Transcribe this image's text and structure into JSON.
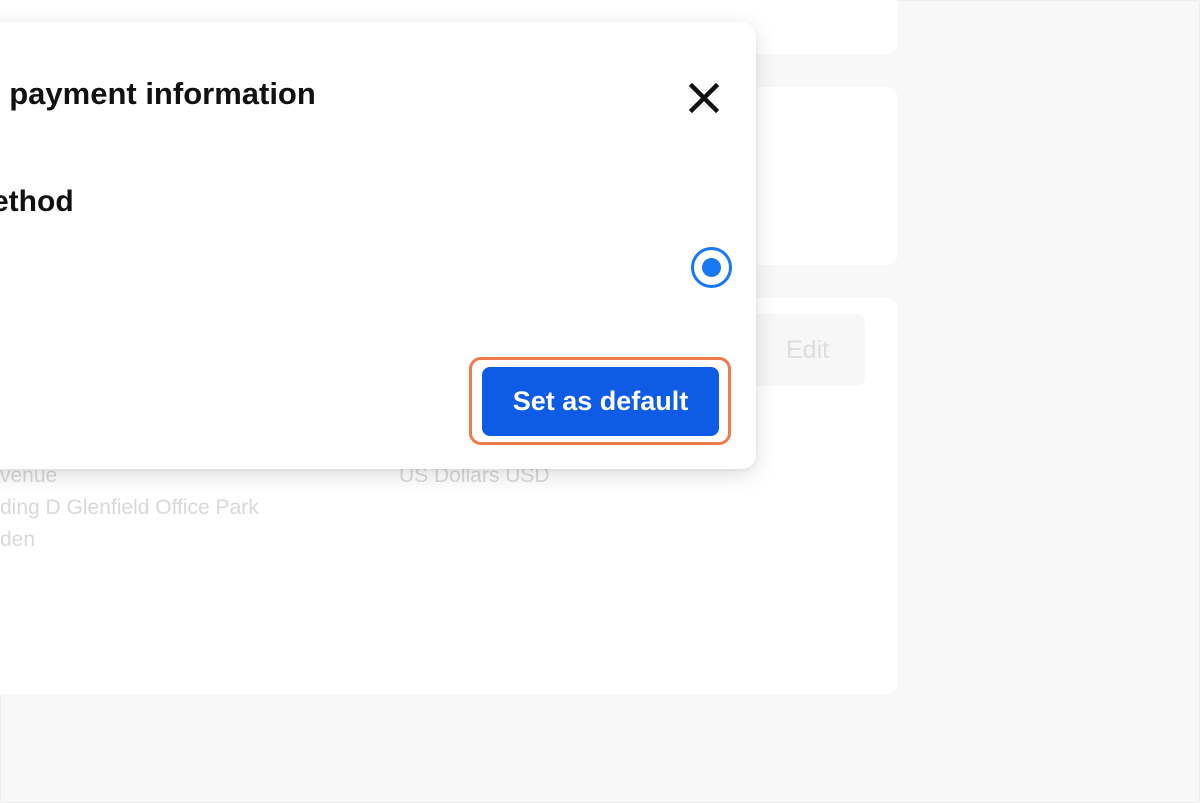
{
  "background": {
    "edit_label": "Edit",
    "address_lines": [
      "venue",
      "ding D Glenfield Office Park",
      "den"
    ],
    "currency": "US Dollars USD"
  },
  "modal": {
    "title": "l payment information",
    "section_title": "ethod",
    "close_icon": "close-icon",
    "radio_selected": true,
    "primary_button_label": "Set as default"
  },
  "colors": {
    "accent": "#1877f2",
    "primary_button": "#0e5ce6",
    "highlight": "#ee7a4d"
  }
}
